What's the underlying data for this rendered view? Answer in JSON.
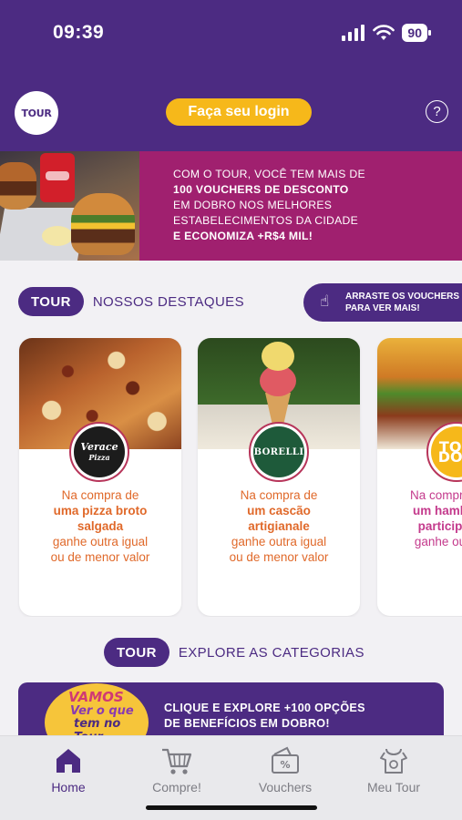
{
  "status": {
    "time": "09:39",
    "battery": "90"
  },
  "header": {
    "logo_text": "TOUR",
    "login_label": "Faça seu login",
    "help_label": "?"
  },
  "banner": {
    "line1": "COM O TOUR, VOCÊ TEM MAIS DE",
    "line2": "100 VOUCHERS DE DESCONTO",
    "line3": "EM DOBRO NOS MELHORES",
    "line4": "ESTABELECIMENTOS DA CIDADE",
    "line5": "E ECONOMIZA +R$4 MIL!"
  },
  "highlights": {
    "pill": "TOUR",
    "title": "NOSSOS DESTAQUES",
    "swipe_hint_line1": "ARRASTE OS VOUCHERS",
    "swipe_hint_line2": "PARA VER MAIS!"
  },
  "cards": [
    {
      "brand": "Verace Pizza",
      "brand_line1": "Verace",
      "brand_line2": "Pizza",
      "line1": "Na compra de",
      "line2": "uma pizza broto",
      "line3": "salgada",
      "line4": "ganhe outra igual",
      "line5": "ou de menor valor",
      "accent": "#e0692a"
    },
    {
      "brand": "Borelli",
      "brand_line1": "BORELLI",
      "line1": "Na compra de",
      "line2": "um cascão",
      "line3": "artigianale",
      "line4": "ganhe outra igual",
      "line5": "ou de menor valor",
      "accent": "#e0692a"
    },
    {
      "brand": "Toodoo",
      "brand_line1": "TOO",
      "brand_line2": "DOO",
      "line1": "Na compra",
      "line2": "um hamb",
      "line3": "particip",
      "line4": "ganhe ou",
      "accent": "#c43a8c"
    }
  ],
  "categories": {
    "pill": "TOUR",
    "title": "EXPLORE AS CATEGORIAS",
    "logo_line1": "VAMOS",
    "logo_line2": "Ver o que",
    "logo_line3": "tem no Tour",
    "line1": "CLIQUE E EXPLORE +100 OPÇÕES",
    "line2": "DE BENEFÍCIOS EM DOBRO!"
  },
  "tabs": [
    {
      "label": "Home",
      "icon": "home-icon",
      "active": true
    },
    {
      "label": "Compre!",
      "icon": "cart-icon",
      "active": false
    },
    {
      "label": "Vouchers",
      "icon": "voucher-icon",
      "active": false
    },
    {
      "label": "Meu Tour",
      "icon": "meu-tour-icon",
      "active": false
    }
  ],
  "colors": {
    "brand_purple": "#4c2b82",
    "accent_yellow": "#f6b81a",
    "banner_magenta": "#a0206f",
    "offer_orange": "#e0692a"
  }
}
